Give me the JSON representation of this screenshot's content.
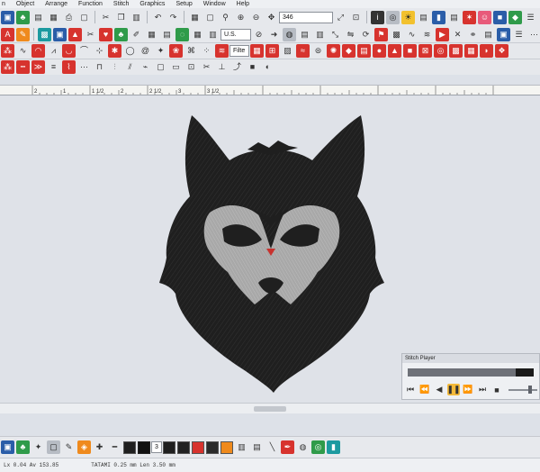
{
  "menu": [
    "n",
    "Object",
    "Arrange",
    "Function",
    "Stitch",
    "Graphics",
    "Setup",
    "Window",
    "Help"
  ],
  "toolbar": {
    "zoom_value": "346",
    "units_value": "U.S.",
    "filter_label": "Filte"
  },
  "ruler": {
    "labels": [
      "2",
      "1",
      "1 1/2",
      "2",
      "2 1/2",
      "3",
      "3 1/2"
    ]
  },
  "stitch_player": {
    "title": "Stitch Player",
    "progress": 0.86,
    "speed": 0.8,
    "buttons": [
      "first-icon",
      "rewind-icon",
      "step-back-icon",
      "pause-icon",
      "fast-forward-icon",
      "last-icon",
      "stop-icon"
    ]
  },
  "bottom": {
    "field_value": "3"
  },
  "status": {
    "coords": "Lx 0.04 Av 153.85",
    "info": "TATAMI 0.25 mm Len 3.50 mm"
  },
  "colors": {
    "fill_dark": "#1f1f1f",
    "fill_light": "#a8a8a8",
    "nose": "#c8322e",
    "accent_active": "#f3b93a"
  }
}
